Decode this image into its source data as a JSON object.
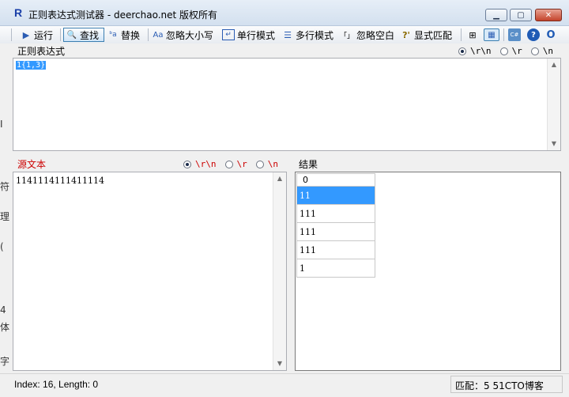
{
  "window": {
    "app_icon": "R",
    "title": "正则表达式测试器 - deerchao.net 版权所有",
    "min_glyph": "▁",
    "max_glyph": "▢",
    "close_glyph": "✕"
  },
  "toolbar": {
    "run_label": "运行",
    "find_label": "查找",
    "replace_label": "替换",
    "ignore_case_label": "忽略大小写",
    "single_line_label": "单行模式",
    "multi_line_label": "多行模式",
    "ignore_whitespace_label": "忽略空白",
    "explicit_capture_label": "显式匹配",
    "run_icon": "▶",
    "find_icon": "🔍",
    "replace_icon": "ᵇa",
    "case_icon": "Aa",
    "single_icon": "↵",
    "multi_icon": "☰",
    "whitespace_icon": "「」",
    "explicit_icon": "?'",
    "tree_icon": "⊞",
    "table_icon": "▦",
    "csharp_icon": "C#",
    "help_icon": "?",
    "o_icon": "O"
  },
  "regex": {
    "label": "正则表达式",
    "value": "1{1,3}",
    "newline_options": [
      "\\r\\n",
      "\\r",
      "\\n"
    ],
    "selected_newline": "\\r\\n"
  },
  "source": {
    "label": "源文本",
    "value": "1141114111411114",
    "newline_options": [
      "\\r\\n",
      "\\r",
      "\\n"
    ],
    "selected_newline": "\\r\\n"
  },
  "results": {
    "label": "结果",
    "column_header": "0",
    "rows": [
      "11",
      "111",
      "111",
      "111",
      "1"
    ],
    "selected_row": 0
  },
  "status": {
    "left_text": "Index: 16, Length: 0",
    "right_text": "匹配：5  51CTO博客"
  },
  "colors": {
    "source_label": "#cc0000",
    "selection": "#3399ff"
  },
  "background_window_chars": [
    "I",
    "符",
    "理",
    "(",
    "4",
    "体",
    "字"
  ]
}
